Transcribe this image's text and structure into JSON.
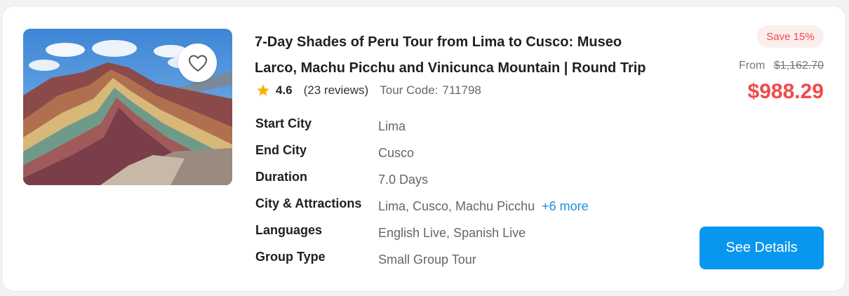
{
  "tour": {
    "title": "7-Day Shades of Peru Tour from Lima to Cusco: Museo Larco, Machu Picchu and Vinicunca Mountain | Round Trip",
    "rating": "4.6",
    "reviews": "(23 reviews)",
    "code_label": "Tour Code:",
    "code": "711798",
    "image_subject": "Vinicunca Rainbow Mountain",
    "favorite_icon": "heart-outline-icon",
    "rating_icon": "star-icon"
  },
  "specs": [
    {
      "label": "Start City",
      "value": "Lima"
    },
    {
      "label": "End City",
      "value": "Cusco"
    },
    {
      "label": "Duration",
      "value": "7.0 Days"
    },
    {
      "label": "City & Attractions",
      "value": "Lima, Cusco, Machu Picchu",
      "more": "+6 more"
    },
    {
      "label": "Languages",
      "value": "English Live, Spanish Live"
    },
    {
      "label": "Group Type",
      "value": "Small Group Tour"
    }
  ],
  "pricing": {
    "save_badge": "Save 15%",
    "from_label": "From",
    "original_price": "$1,162.70",
    "price": "$988.29"
  },
  "actions": {
    "details_label": "See Details"
  },
  "colors": {
    "accent_blue": "#0996ef",
    "price_red": "#f04a4a",
    "star": "#f5b400",
    "link": "#1a90e0"
  }
}
